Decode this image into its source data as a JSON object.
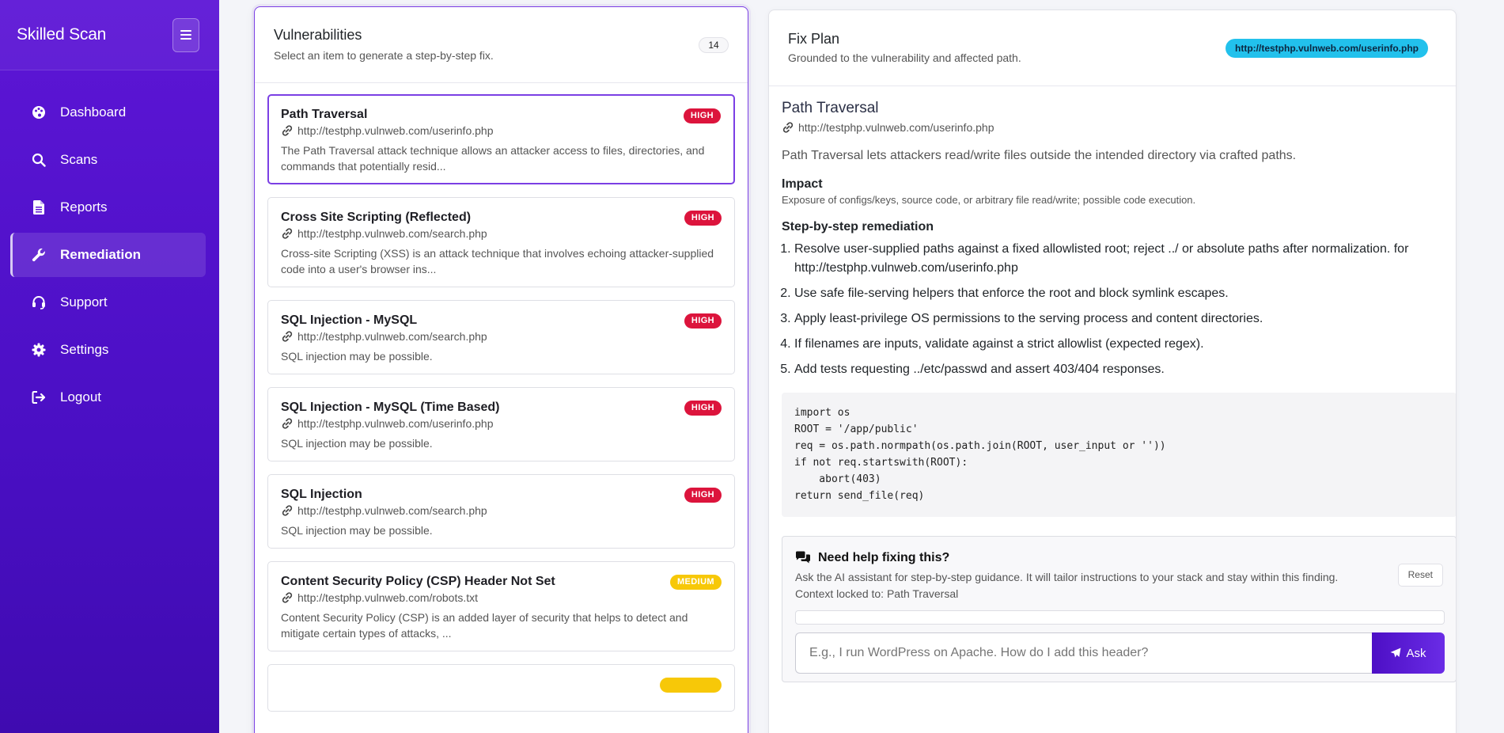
{
  "app": {
    "brand": "Skilled Scan"
  },
  "sidebar": {
    "items": [
      {
        "label": "Dashboard",
        "icon": "palette-icon",
        "active": false
      },
      {
        "label": "Scans",
        "icon": "search-icon",
        "active": false
      },
      {
        "label": "Reports",
        "icon": "file-icon",
        "active": false
      },
      {
        "label": "Remediation",
        "icon": "wrench-icon",
        "active": true
      },
      {
        "label": "Support",
        "icon": "headset-icon",
        "active": false
      },
      {
        "label": "Settings",
        "icon": "gear-icon",
        "active": false
      },
      {
        "label": "Logout",
        "icon": "logout-icon",
        "active": false
      }
    ]
  },
  "vulnerabilities": {
    "title": "Vulnerabilities",
    "subtitle": "Select an item to generate a step-by-step fix.",
    "count": "14",
    "items": [
      {
        "name": "Path Traversal",
        "severity": "HIGH",
        "url": "http://testphp.vulnweb.com/userinfo.php",
        "desc": "The Path Traversal attack technique allows an attacker access to files, directories, and commands that potentially resid..."
      },
      {
        "name": "Cross Site Scripting (Reflected)",
        "severity": "HIGH",
        "url": "http://testphp.vulnweb.com/search.php",
        "desc": "Cross-site Scripting (XSS) is an attack technique that involves echoing attacker-supplied code into a user's browser ins..."
      },
      {
        "name": "SQL Injection - MySQL",
        "severity": "HIGH",
        "url": "http://testphp.vulnweb.com/search.php",
        "desc": "SQL injection may be possible."
      },
      {
        "name": "SQL Injection - MySQL (Time Based)",
        "severity": "HIGH",
        "url": "http://testphp.vulnweb.com/userinfo.php",
        "desc": "SQL injection may be possible."
      },
      {
        "name": "SQL Injection",
        "severity": "HIGH",
        "url": "http://testphp.vulnweb.com/search.php",
        "desc": "SQL injection may be possible."
      },
      {
        "name": "Content Security Policy (CSP) Header Not Set",
        "severity": "MEDIUM",
        "url": "http://testphp.vulnweb.com/robots.txt",
        "desc": "Content Security Policy (CSP) is an added layer of security that helps to detect and mitigate certain types of attacks, ..."
      }
    ]
  },
  "fix_plan": {
    "title": "Fix Plan",
    "subtitle": "Grounded to the vulnerability and affected path.",
    "url_badge": "http://testphp.vulnweb.com/userinfo.php",
    "vuln_title": "Path Traversal",
    "vuln_url": "http://testphp.vulnweb.com/userinfo.php",
    "summary": "Path Traversal lets attackers read/write files outside the intended directory via crafted paths.",
    "impact_heading": "Impact",
    "impact": "Exposure of configs/keys, source code, or arbitrary file read/write; possible code execution.",
    "steps_heading": "Step-by-step remediation",
    "steps": [
      "Resolve user-supplied paths against a fixed allowlisted root; reject ../ or absolute paths after normalization. for http://testphp.vulnweb.com/userinfo.php",
      "Use safe file-serving helpers that enforce the root and block symlink escapes.",
      "Apply least-privilege OS permissions to the serving process and content directories.",
      "If filenames are inputs, validate against a strict allowlist (expected regex).",
      "Add tests requesting ../etc/passwd and assert 403/404 responses."
    ],
    "code": "import os\nROOT = '/app/public'\nreq = os.path.normpath(os.path.join(ROOT, user_input or ''))\nif not req.startswith(ROOT):\n    abort(403)\nreturn send_file(req)"
  },
  "help": {
    "title": "Need help fixing this?",
    "subtitle": "Ask the AI assistant for step-by-step guidance. It will tailor instructions to your stack and stay within this finding.",
    "context": "Context locked to: Path Traversal",
    "reset_label": "Reset",
    "input_placeholder": "E.g., I run WordPress on Apache. How do I add this header?",
    "ask_label": "Ask"
  },
  "colors": {
    "sidebar": "#5d16d6",
    "accent": "#7b3fe4",
    "high": "#dc143c",
    "medium": "#f7c808",
    "url_badge": "#22c1ec"
  }
}
